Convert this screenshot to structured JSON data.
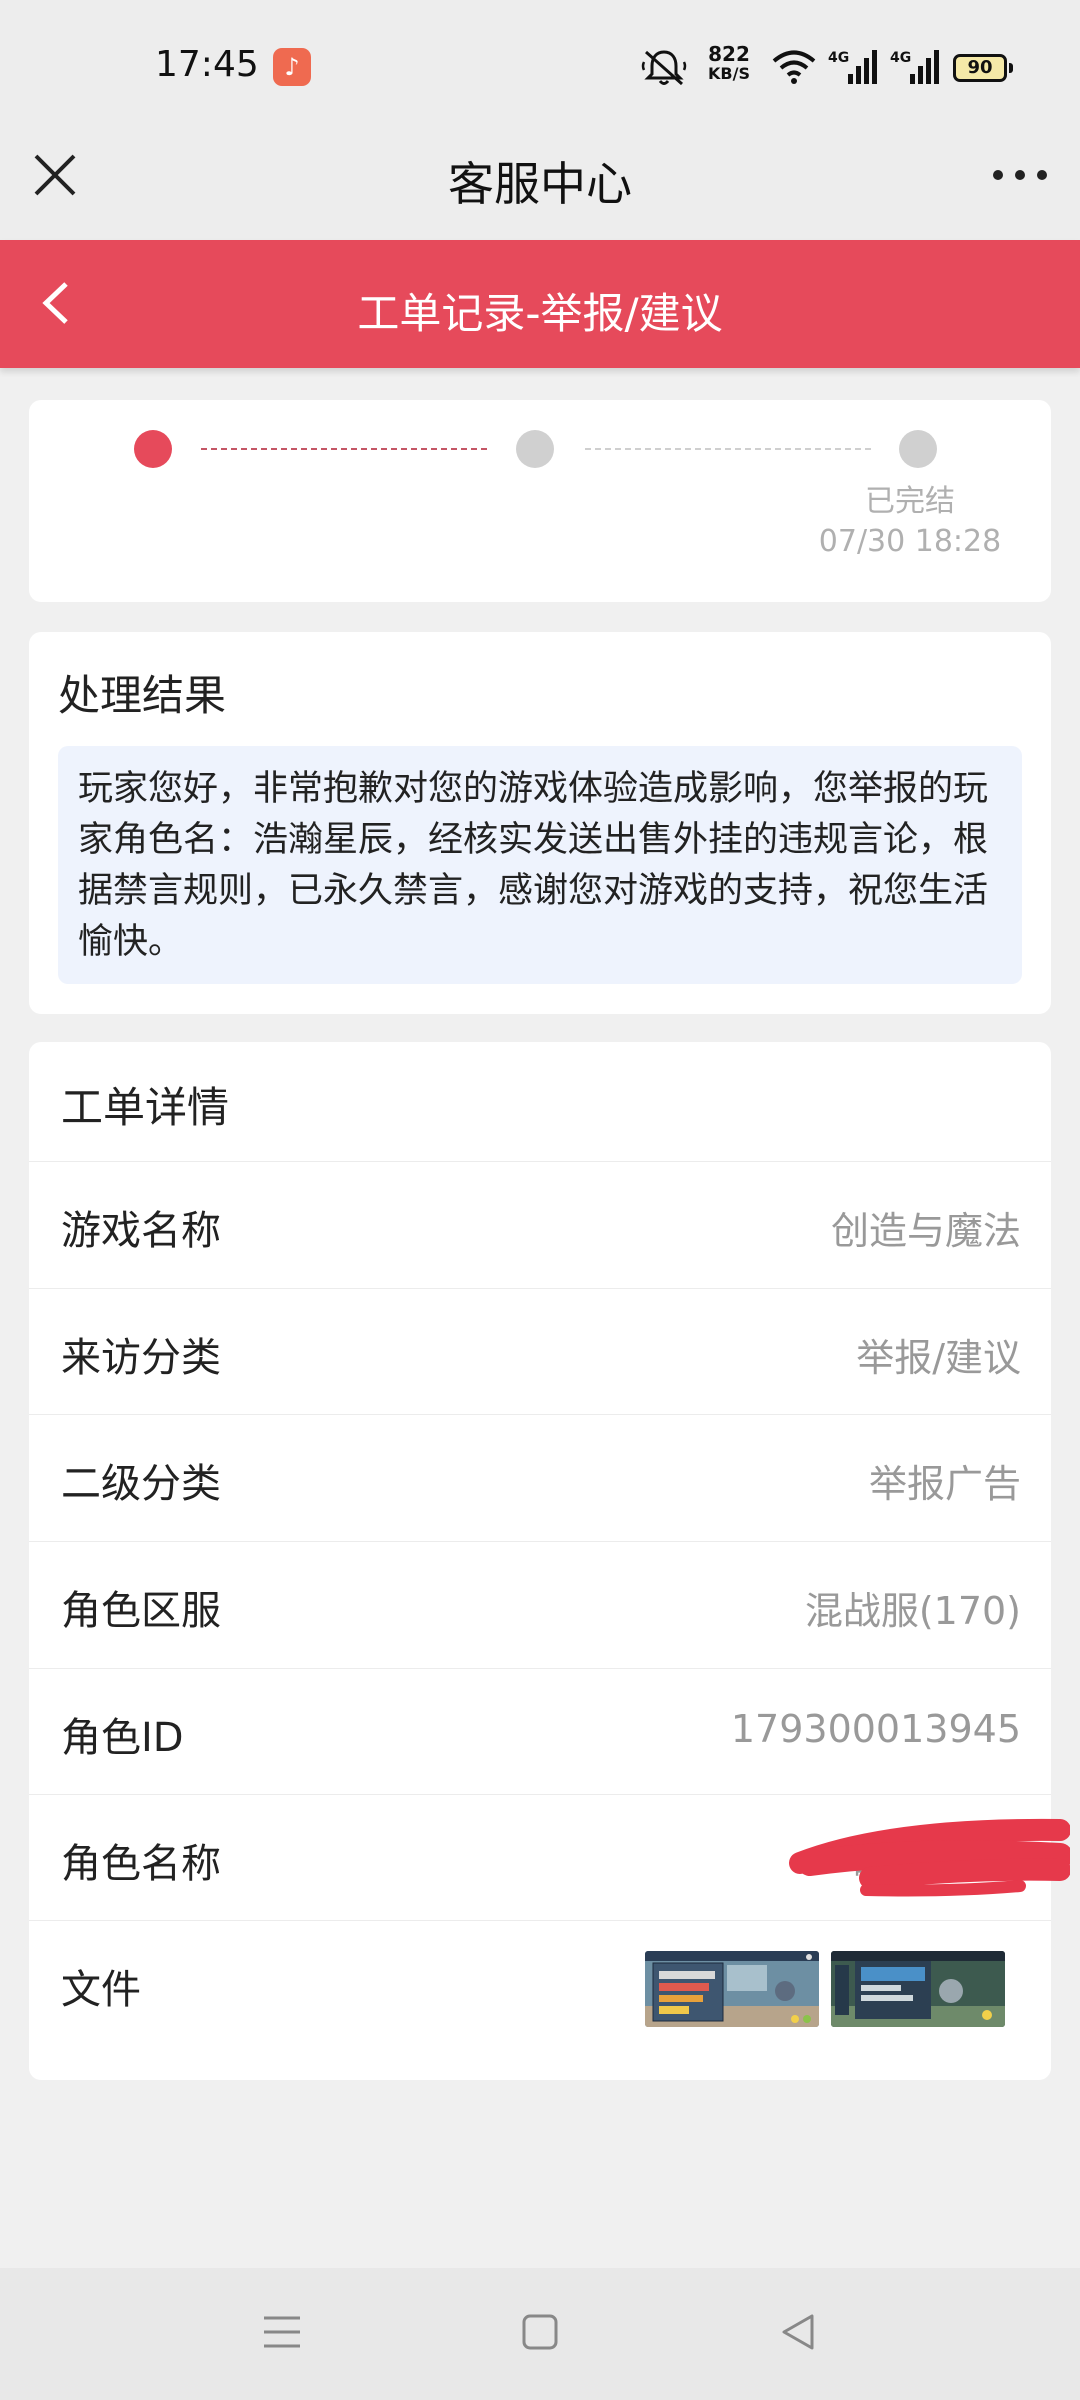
{
  "status_bar": {
    "time": "17:45",
    "speed_value": "822",
    "speed_unit": "KB/S",
    "battery": "90",
    "icons": [
      "music-app-icon",
      "mute-bell-icon",
      "wifi-icon",
      "signal-4g-icon",
      "signal-4g-icon",
      "battery-icon"
    ]
  },
  "title_bar": {
    "title": "客服中心",
    "icons": [
      "close-icon",
      "more-icon"
    ]
  },
  "header": {
    "title": "工单记录-举报/建议",
    "icon": "back-chevron-icon",
    "color": "#e64a5b"
  },
  "progress": {
    "current_step": 1,
    "final_label": "已完结",
    "final_time": "07/30 18:28",
    "active_color": "#e64a5b",
    "inactive_color": "#d0d0d0"
  },
  "result": {
    "title": "处理结果",
    "text": "玩家您好，非常抱歉对您的游戏体验造成影响，您举报的玩家角色名：浩瀚星辰，经核实发送出售外挂的违规言论，根据禁言规则，已永久禁言，感谢您对游戏的支持，祝您生活愉快。"
  },
  "details": {
    "title": "工单详情",
    "rows": [
      {
        "label": "游戏名称",
        "value": "创造与魔法"
      },
      {
        "label": "来访分类",
        "value": "举报/建议"
      },
      {
        "label": "二级分类",
        "value": "举报广告"
      },
      {
        "label": "角色区服",
        "value": "混战服(170)"
      },
      {
        "label": "角色ID",
        "value": "179300013945"
      },
      {
        "label": "角色名称",
        "value": "晴"
      },
      {
        "label": "文件",
        "value": ""
      }
    ],
    "file_thumbnails": [
      "screenshot-thumbnail-1",
      "screenshot-thumbnail-2"
    ]
  },
  "nav_bar": {
    "icons": [
      "menu-icon",
      "home-square-icon",
      "back-triangle-icon"
    ]
  }
}
